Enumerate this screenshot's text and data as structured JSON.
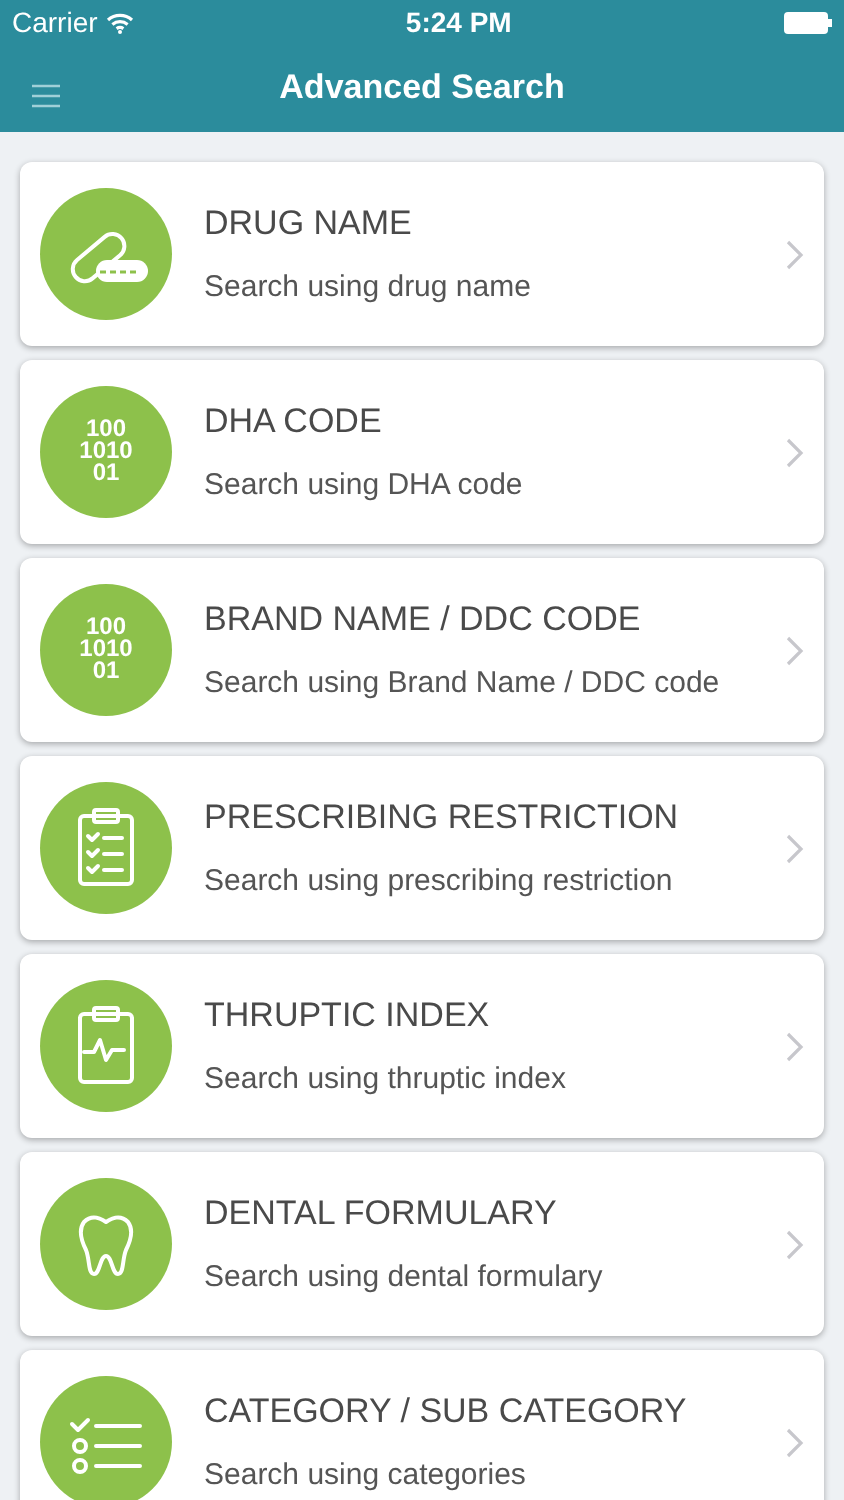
{
  "status_bar": {
    "carrier": "Carrier",
    "time": "5:24 PM"
  },
  "header": {
    "title": "Advanced Search"
  },
  "items": [
    {
      "kind": "pill",
      "title": "DRUG NAME",
      "subtitle": "Search using drug name"
    },
    {
      "kind": "binary",
      "icon_lines": [
        "100",
        "1010",
        "01"
      ],
      "title": "DHA CODE",
      "subtitle": "Search using DHA code"
    },
    {
      "kind": "binary",
      "icon_lines": [
        "100",
        "1010",
        "01"
      ],
      "title": "BRAND NAME / DDC CODE",
      "subtitle": "Search using Brand Name / DDC code"
    },
    {
      "kind": "checklist-clipboard",
      "title": "PRESCRIBING RESTRICTION",
      "subtitle": "Search using prescribing restriction"
    },
    {
      "kind": "pulse-clipboard",
      "title": "THRUPTIC INDEX",
      "subtitle": "Search using thruptic index"
    },
    {
      "kind": "tooth",
      "title": "DENTAL FORMULARY",
      "subtitle": "Search using dental formulary"
    },
    {
      "kind": "list",
      "title": "CATEGORY / SUB CATEGORY",
      "subtitle": "Search using categories"
    }
  ]
}
